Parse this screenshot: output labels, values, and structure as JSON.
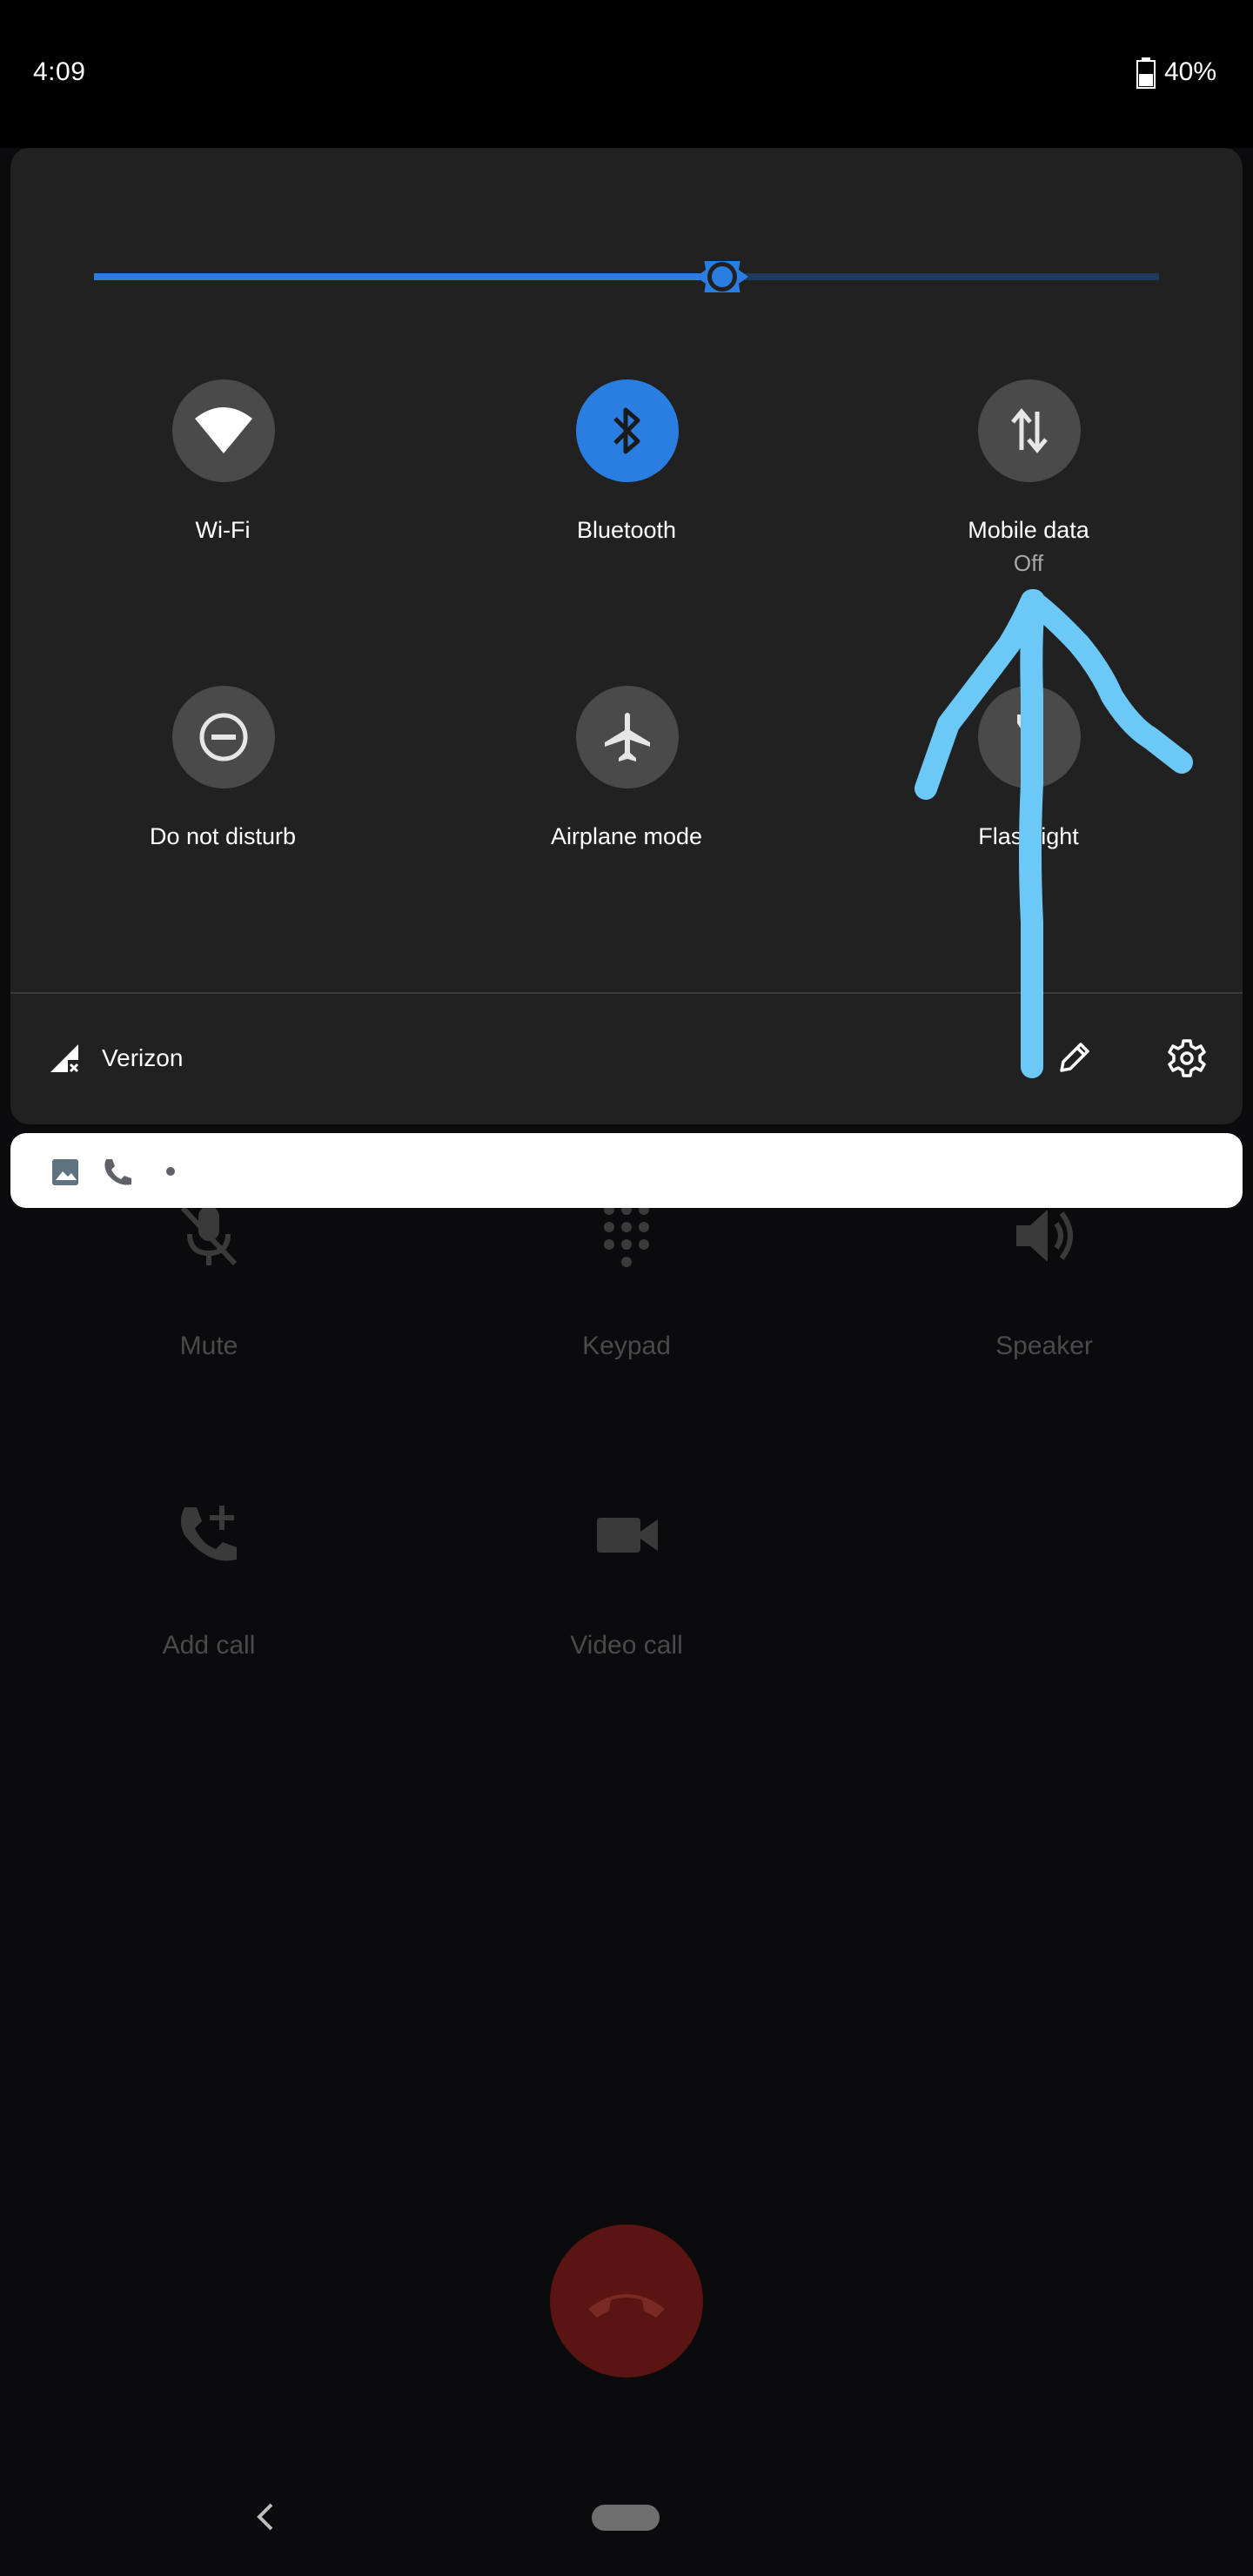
{
  "status_bar": {
    "time": "4:09",
    "battery": "40%"
  },
  "quick_settings": {
    "brightness_level": 0.59,
    "tiles": [
      {
        "label": "Wi-Fi",
        "icon": "wifi-icon",
        "state": "off"
      },
      {
        "label": "Bluetooth",
        "icon": "bluetooth-icon",
        "state": "on"
      },
      {
        "label": "Mobile data",
        "sub": "Off",
        "icon": "mobile-data-icon",
        "state": "off"
      },
      {
        "label": "Do not disturb",
        "icon": "do-not-disturb-icon",
        "state": "off"
      },
      {
        "label": "Airplane mode",
        "icon": "airplane-icon",
        "state": "off"
      },
      {
        "label": "Flashlight",
        "icon": "flashlight-icon",
        "state": "off"
      }
    ],
    "carrier": "Verizon"
  },
  "call_controls": {
    "mute": "Mute",
    "keypad": "Keypad",
    "speaker": "Speaker",
    "add_call": "Add call",
    "video_call": "Video call"
  },
  "colors": {
    "accent": "#2a7de1",
    "annotation": "#6cc9f7",
    "end_call": "#5a1512"
  }
}
